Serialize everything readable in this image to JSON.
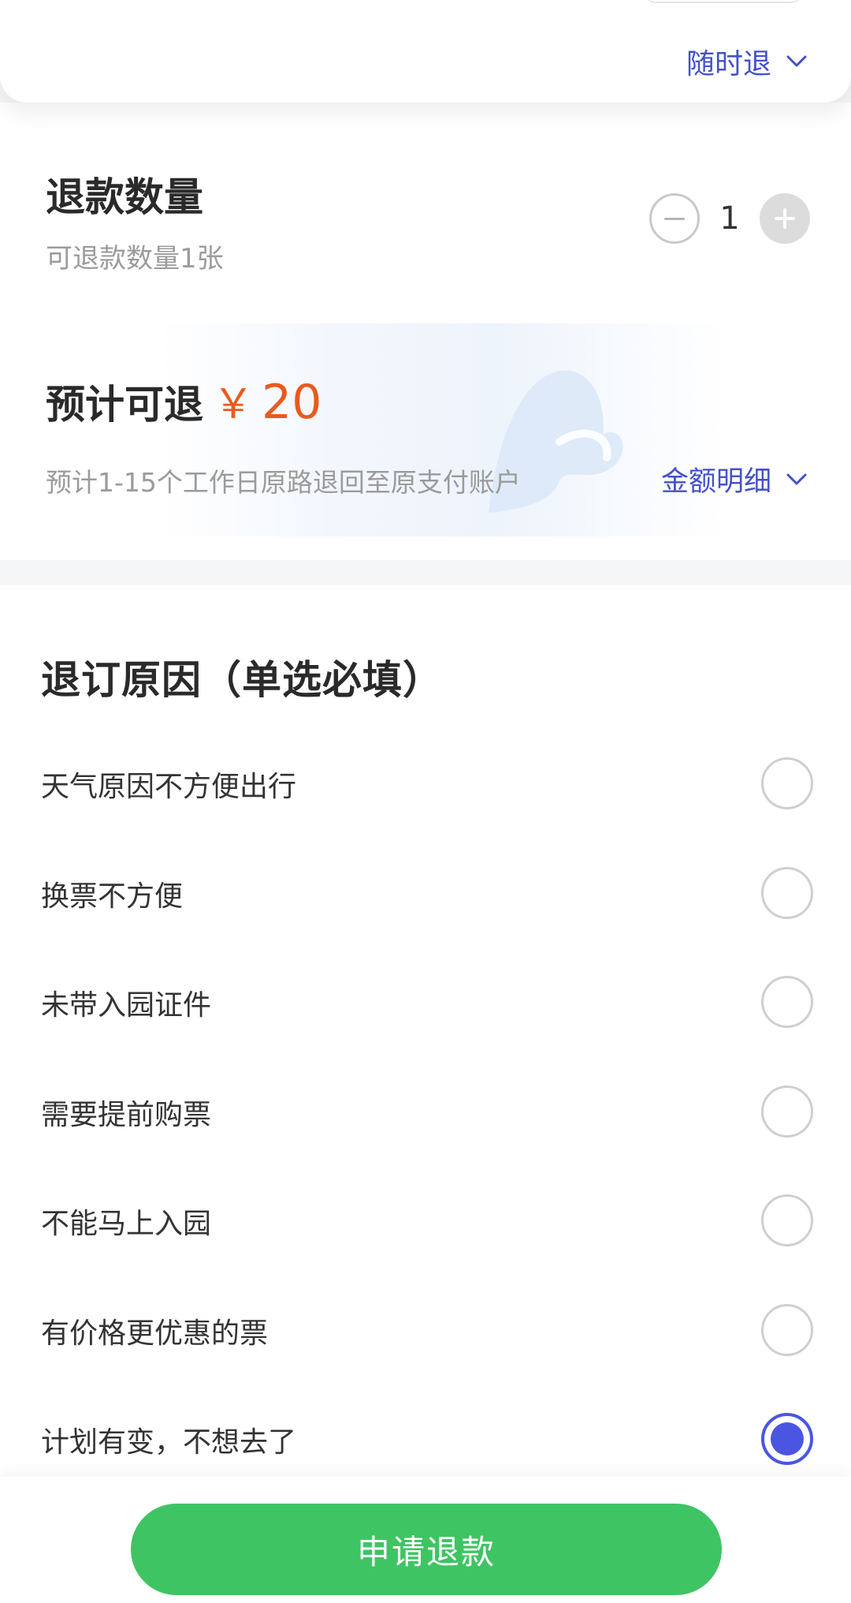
{
  "policy": {
    "label": "随时退",
    "icon": "chevron-down-icon"
  },
  "quantity": {
    "title": "退款数量",
    "subtitle": "可退款数量1张",
    "value": "1"
  },
  "estimate": {
    "title": "预计可退",
    "currency": "￥",
    "amount": "20",
    "note": "预计1-15个工作日原路退回至原支付账户",
    "detail_label": "金额明细",
    "accent_color": "#ea5a1c"
  },
  "reasons": {
    "title": "退订原因（单选必填）",
    "items": [
      {
        "label": "天气原因不方便出行",
        "selected": false
      },
      {
        "label": "换票不方便",
        "selected": false
      },
      {
        "label": "未带入园证件",
        "selected": false
      },
      {
        "label": "需要提前购票",
        "selected": false
      },
      {
        "label": "不能马上入园",
        "selected": false
      },
      {
        "label": "有价格更优惠的票",
        "selected": false
      },
      {
        "label": "计划有变，不想去了",
        "selected": true
      }
    ]
  },
  "submit": {
    "label": "申请退款",
    "color": "#3fc463"
  },
  "theme": {
    "link_color": "#4451c9",
    "radio_selected_color": "#4a56e2"
  }
}
